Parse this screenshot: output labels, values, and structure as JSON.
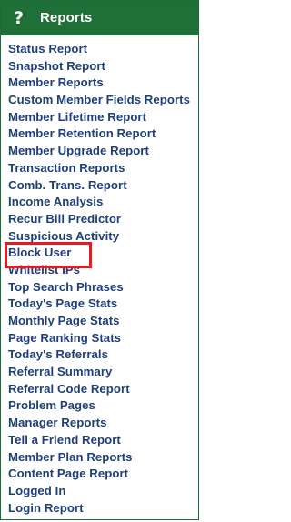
{
  "header": {
    "title": "Reports",
    "icon": "question-mark-icon",
    "background_color": "#1f6f38"
  },
  "menu": {
    "link_color": "#1f3f7a",
    "highlight_color": "#e21b24",
    "highlighted_item": "Block User",
    "items": [
      {
        "label": "Status Report"
      },
      {
        "label": "Snapshot Report"
      },
      {
        "label": "Member Reports"
      },
      {
        "label": "Custom Member Fields Reports"
      },
      {
        "label": "Member Lifetime Report"
      },
      {
        "label": "Member Retention Report"
      },
      {
        "label": "Member Upgrade Report"
      },
      {
        "label": "Transaction Reports"
      },
      {
        "label": "Comb. Trans. Report"
      },
      {
        "label": "Income Analysis"
      },
      {
        "label": "Recur Bill Predictor"
      },
      {
        "label": "Suspicious Activity"
      },
      {
        "label": "Block User"
      },
      {
        "label": "Whitelist IPs"
      },
      {
        "label": "Top Search Phrases"
      },
      {
        "label": "Today's Page Stats"
      },
      {
        "label": "Monthly Page Stats"
      },
      {
        "label": "Page Ranking Stats"
      },
      {
        "label": "Today's Referrals"
      },
      {
        "label": "Referral Summary"
      },
      {
        "label": "Referral Code Report"
      },
      {
        "label": "Problem Pages"
      },
      {
        "label": "Manager Reports"
      },
      {
        "label": "Tell a Friend Report"
      },
      {
        "label": "Member Plan Reports"
      },
      {
        "label": "Content Page Report"
      },
      {
        "label": "Logged In"
      },
      {
        "label": "Login Report"
      }
    ]
  }
}
